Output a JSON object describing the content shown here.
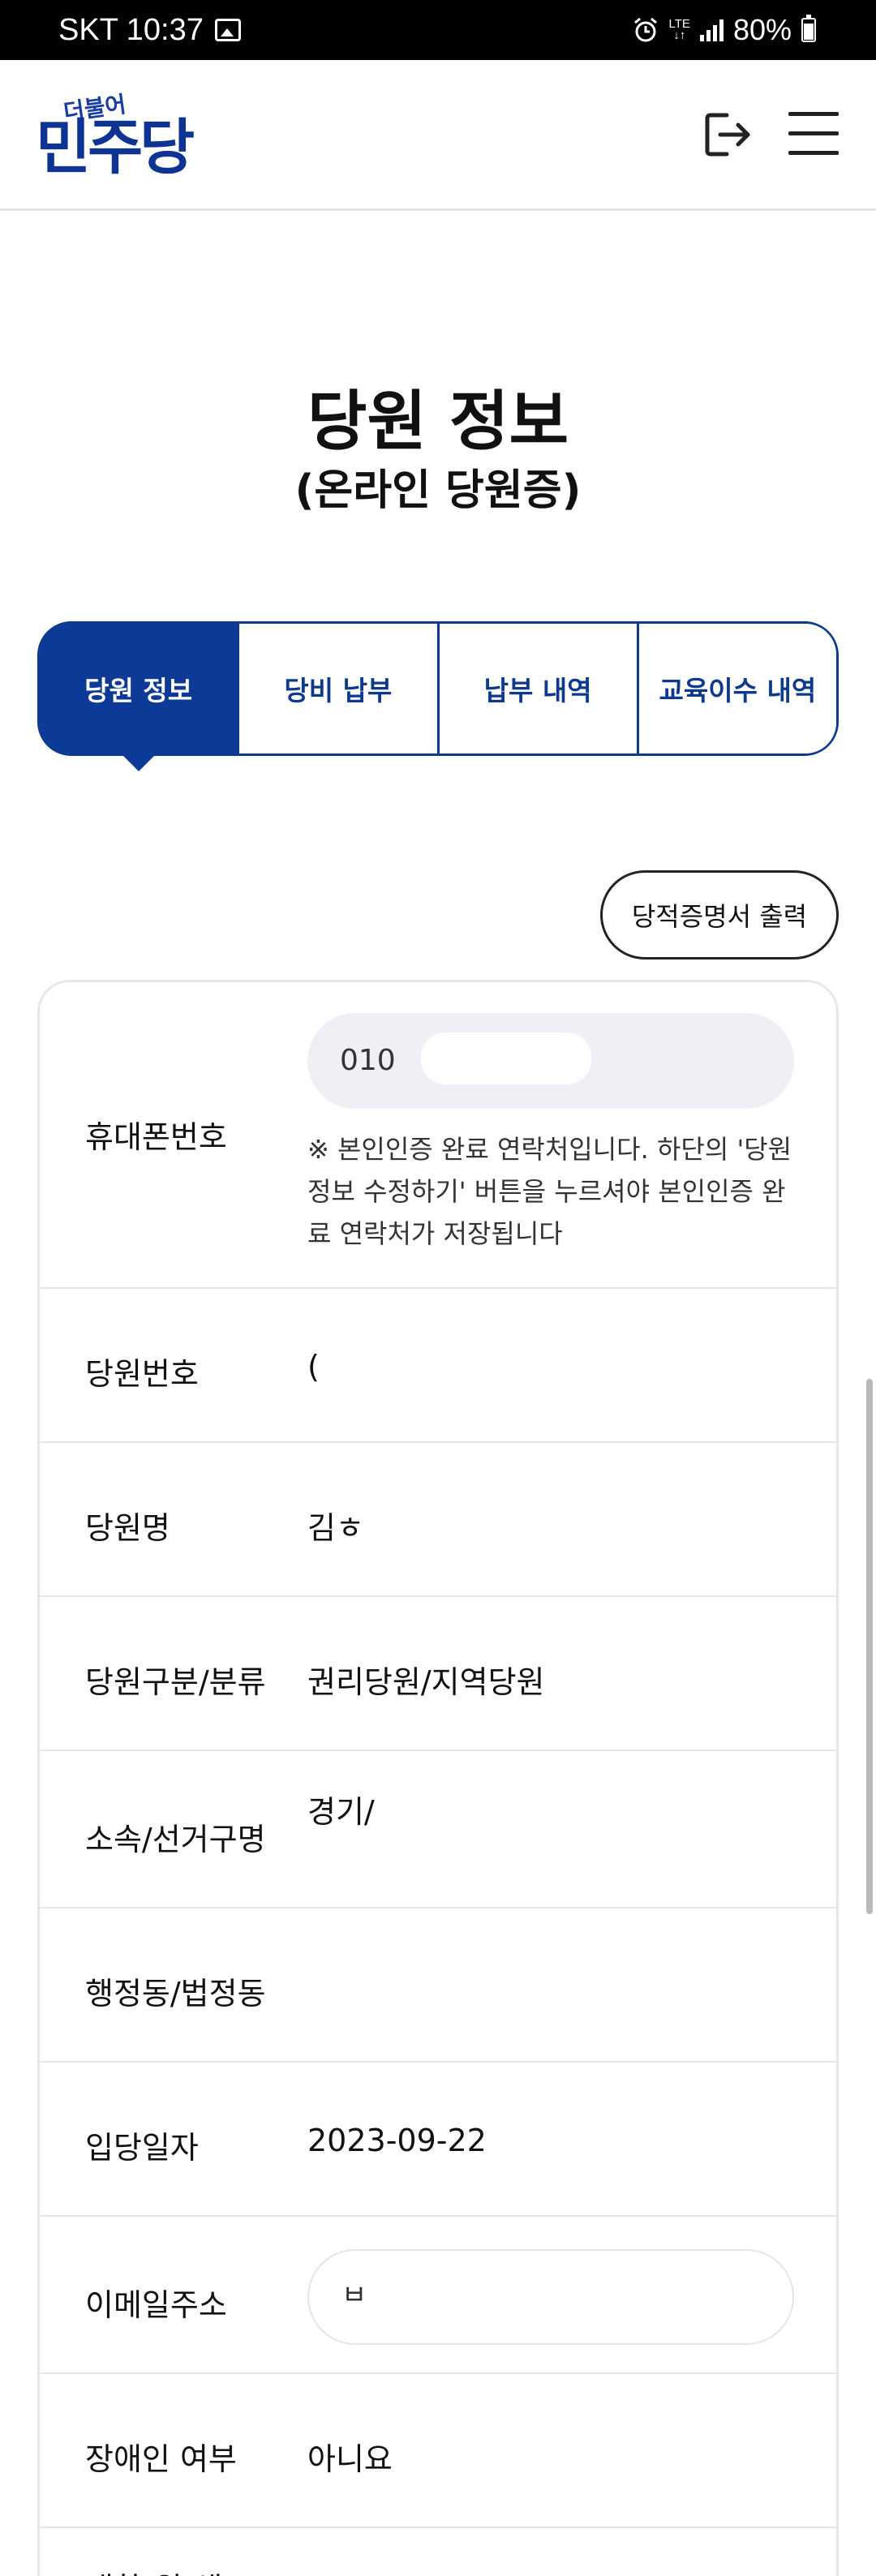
{
  "status_bar": {
    "carrier_time": "SKT 10:37",
    "network": "LTE",
    "battery": "80%"
  },
  "header": {
    "logo_sub": "더불어",
    "logo_main": "민주당",
    "logout_icon": "logout-icon",
    "menu_icon": "hamburger-menu-icon"
  },
  "page": {
    "title": "당원 정보",
    "subtitle": "(온라인 당원증)"
  },
  "tabs": [
    {
      "label": "당원 정보",
      "active": true
    },
    {
      "label": "당비 납부",
      "active": false
    },
    {
      "label": "납부 내역",
      "active": false
    },
    {
      "label": "교육이수 내역",
      "active": false
    }
  ],
  "certificate_button": "당적증명서 출력",
  "member_info": {
    "phone": {
      "label": "휴대폰번호",
      "value": "010",
      "note": "※ 본인인증 완료 연락처입니다. 하단의 '당원 정보 수정하기' 버튼을 누르셔야 본인인증 완료 연락처가 저장됩니다"
    },
    "member_number": {
      "label": "당원번호",
      "value": "("
    },
    "member_name": {
      "label": "당원명",
      "value": "김ㅎ"
    },
    "member_type": {
      "label": "당원구분/분류",
      "value": "권리당원/지역당원"
    },
    "affiliation": {
      "label": "소속/선거구명",
      "value": "경기/"
    },
    "district": {
      "label": "행정동/법정동",
      "value": ""
    },
    "join_date": {
      "label": "입당일자",
      "value": "2023-09-22"
    },
    "email": {
      "label": "이메일주소",
      "value": "ㅂ"
    },
    "disability": {
      "label": "장애인 여부",
      "value": "아니요"
    },
    "partial_next": {
      "label": "대학(원)생"
    }
  }
}
